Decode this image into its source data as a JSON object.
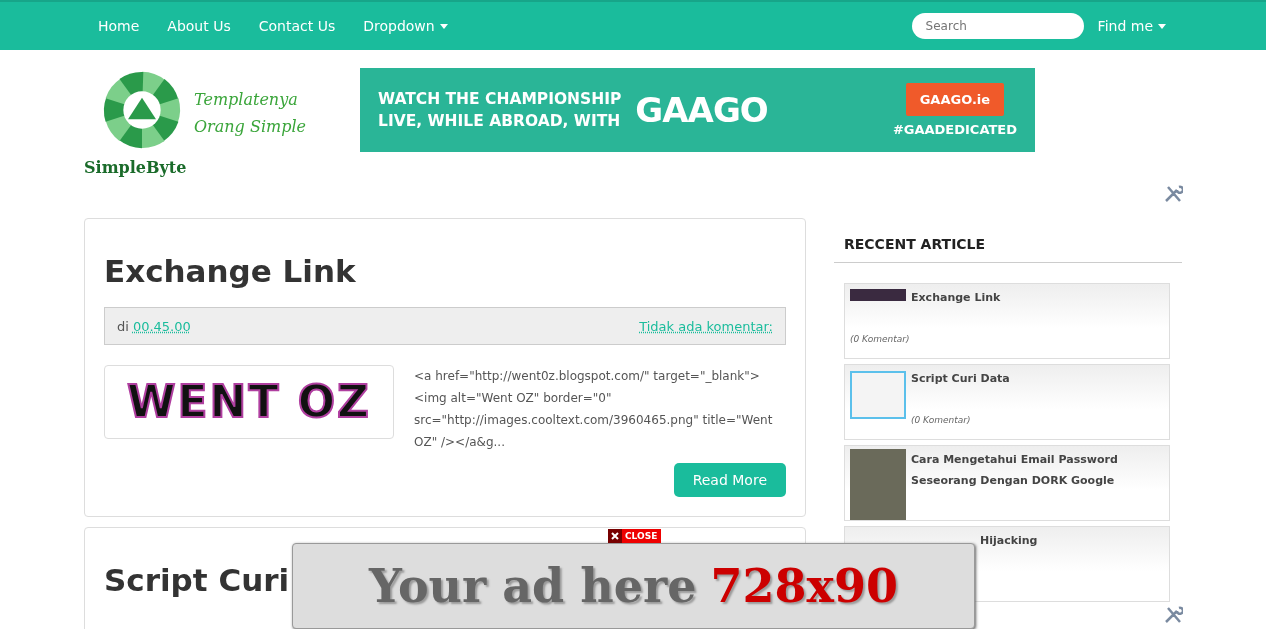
{
  "nav": {
    "items": [
      {
        "label": "Home",
        "kind": "link"
      },
      {
        "label": "About Us",
        "kind": "link"
      },
      {
        "label": "Contact Us",
        "kind": "link"
      },
      {
        "label": "Dropdown",
        "kind": "dropdown"
      }
    ],
    "search": {
      "placeholder": "Search"
    },
    "find_me": {
      "label": "Find me",
      "kind": "dropdown"
    }
  },
  "header": {
    "logo": {
      "tagline": [
        "Templatenya",
        "Orang Simple"
      ],
      "brand": "SimpleByte"
    },
    "banner": {
      "headline": [
        "WATCH THE CHAMPIONSHIP",
        "LIVE, WHILE ABROAD, WITH"
      ],
      "brand": "GAAGO",
      "button": "GAAGO.ie",
      "hashtag": "#GAADEDICATED"
    }
  },
  "posts": [
    {
      "title": "Exchange Link",
      "meta_prefix": "di",
      "time": "00.45.00",
      "comments": "Tidak ada komentar:",
      "thumbnail_text": "WENT OZ",
      "excerpt": "<a href=\"http://went0z.blogspot.com/\" target=\"_blank\"><img alt=\"Went OZ\" border=\"0\" src=\"http://images.cooltext.com/3960465.png\" title=\"Went OZ\" /></a&g...",
      "button": "Read More"
    },
    {
      "title": "Script Curi"
    }
  ],
  "sidebar": {
    "title": "RECCENT ARTICLE",
    "items": [
      {
        "title": "Exchange Link",
        "comments": "(0 Komentar)",
        "kind": "banner"
      },
      {
        "title": "Script Curi Data",
        "comments": "(0 Komentar)",
        "kind": "framed"
      },
      {
        "title": "Cara Mengetahui Email Password Seseorang Dengan DORK Google",
        "kind": "poster"
      },
      {
        "title": "Hijacking",
        "kind": "covered"
      }
    ]
  },
  "overlay_ad": {
    "close": "CLOSE",
    "text": "Your ad here",
    "size": "728x90"
  }
}
